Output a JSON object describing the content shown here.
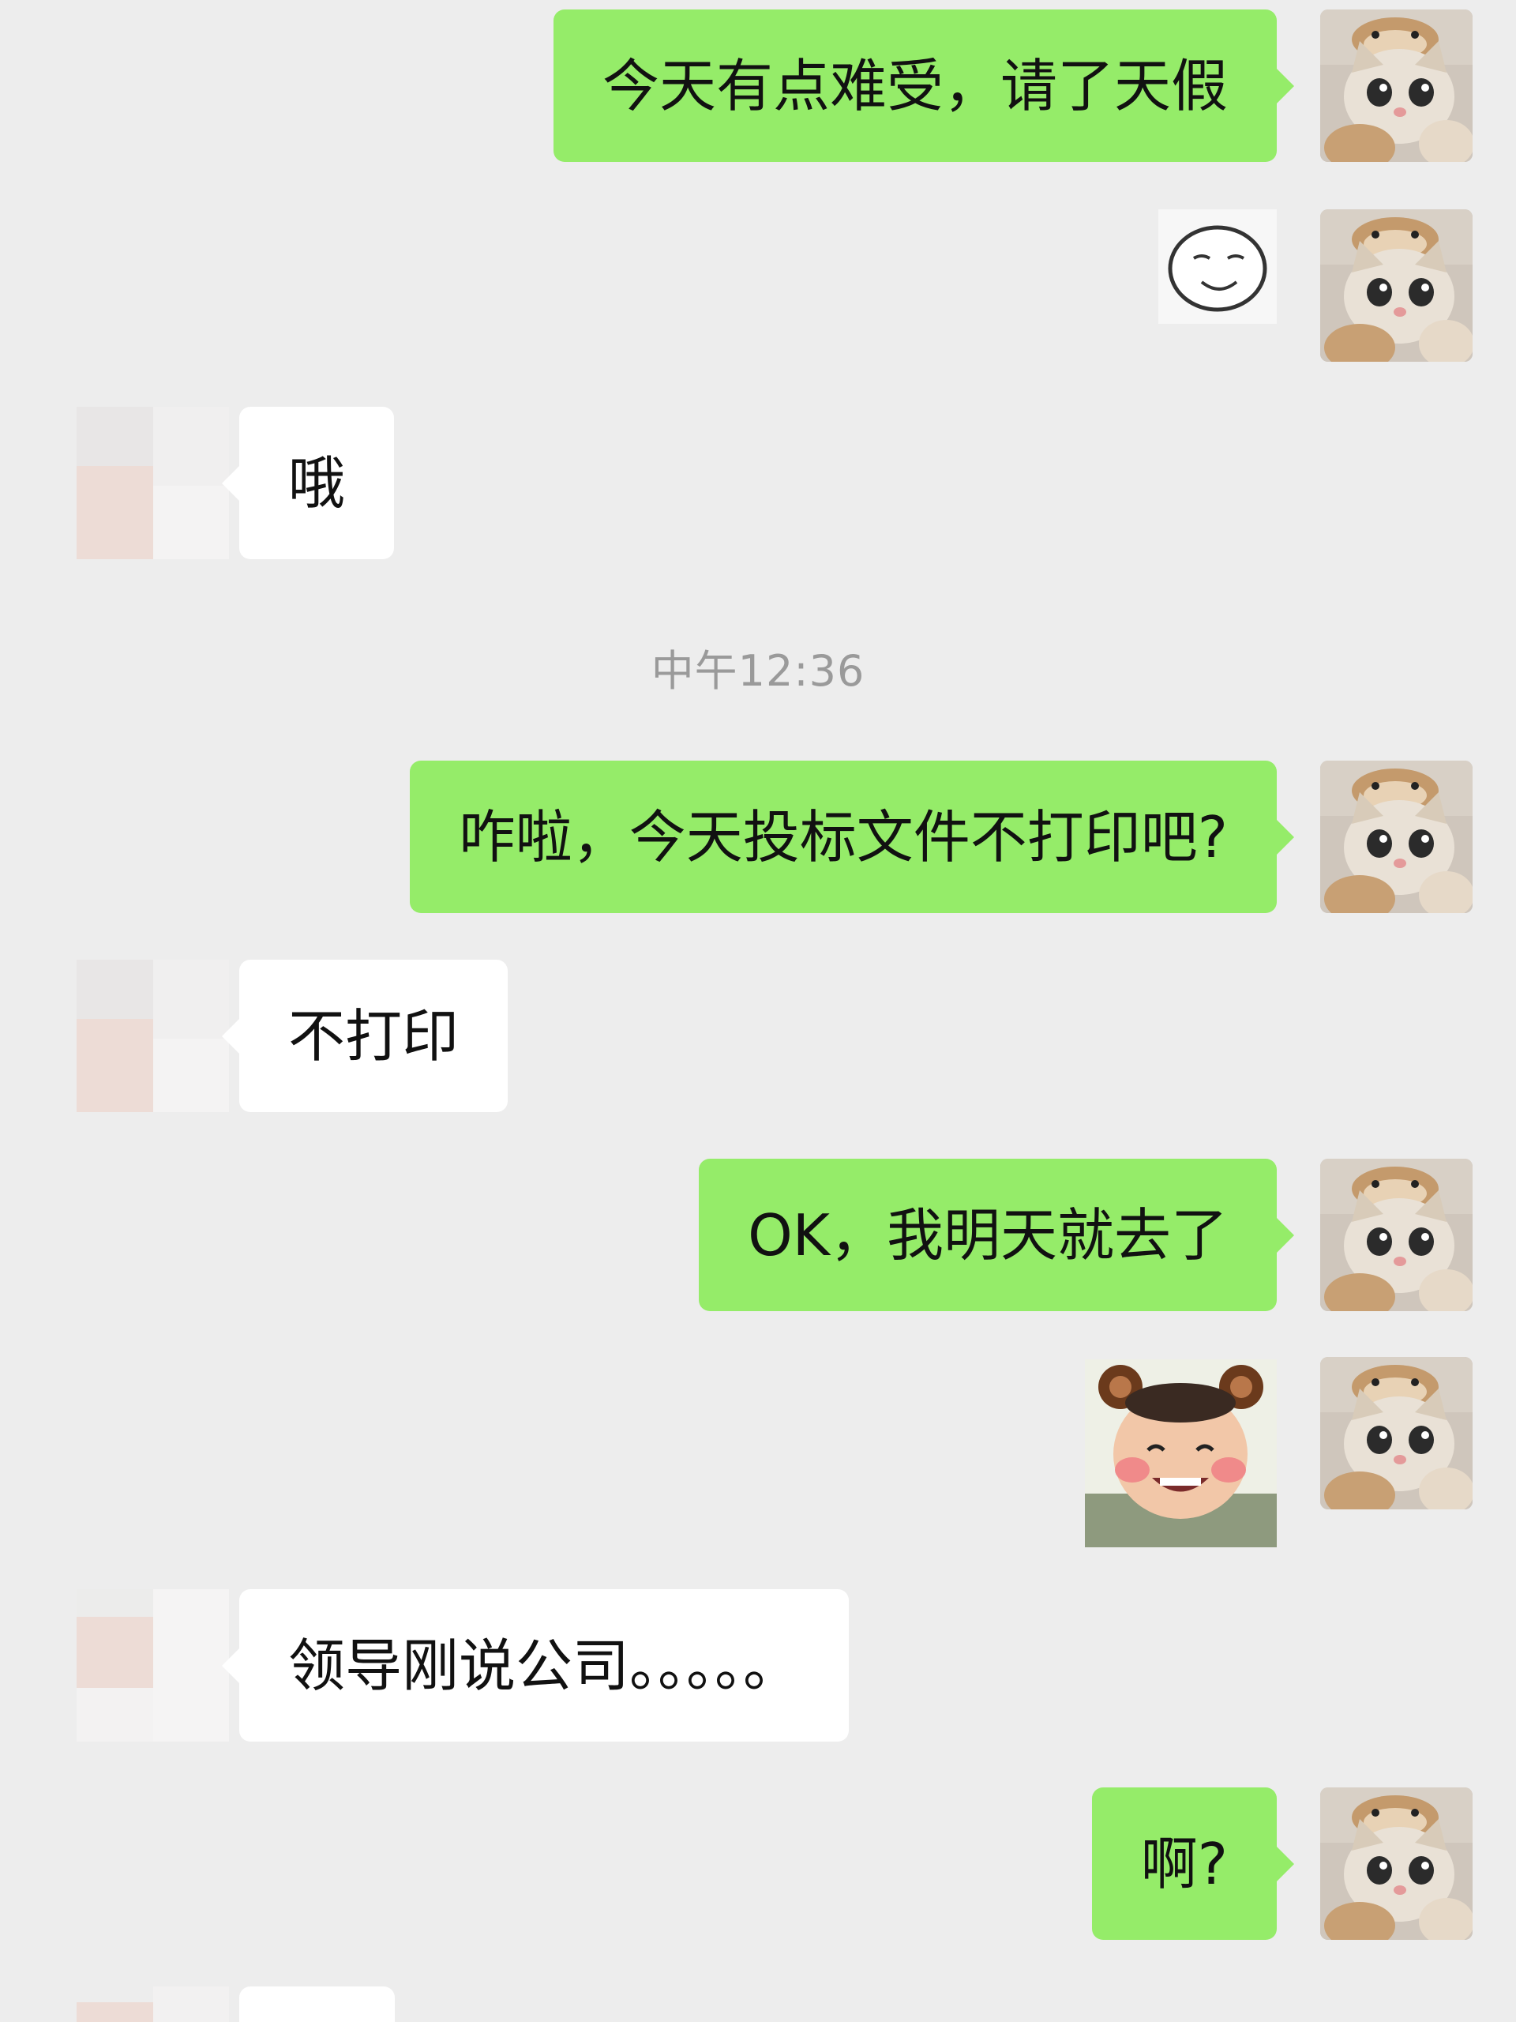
{
  "chat": {
    "timestamp": "中午12:36",
    "messages": [
      {
        "sender": "me",
        "text": "今天有点难受，请了天假"
      },
      {
        "sender": "me",
        "sticker": "smiling-face-doodle-sticker"
      },
      {
        "sender": "other",
        "text": "哦"
      },
      {
        "sender": "me",
        "text": "咋啦，今天投标文件不打印吧?"
      },
      {
        "sender": "other",
        "text": "不打印"
      },
      {
        "sender": "me",
        "text": "OK，我明天就去了"
      },
      {
        "sender": "me",
        "sticker": "bear-ears-baby-sticker"
      },
      {
        "sender": "other",
        "text": "领导刚说公司。。。。。"
      },
      {
        "sender": "me",
        "text": "啊?"
      }
    ]
  },
  "colors": {
    "background": "#ededed",
    "my_bubble": "#95ec69",
    "other_bubble": "#ffffff",
    "timestamp_text": "#9a9a9a"
  },
  "icons": {
    "my_avatar": "cat-avatar-icon",
    "other_avatar": "blurred-avatar-icon"
  }
}
